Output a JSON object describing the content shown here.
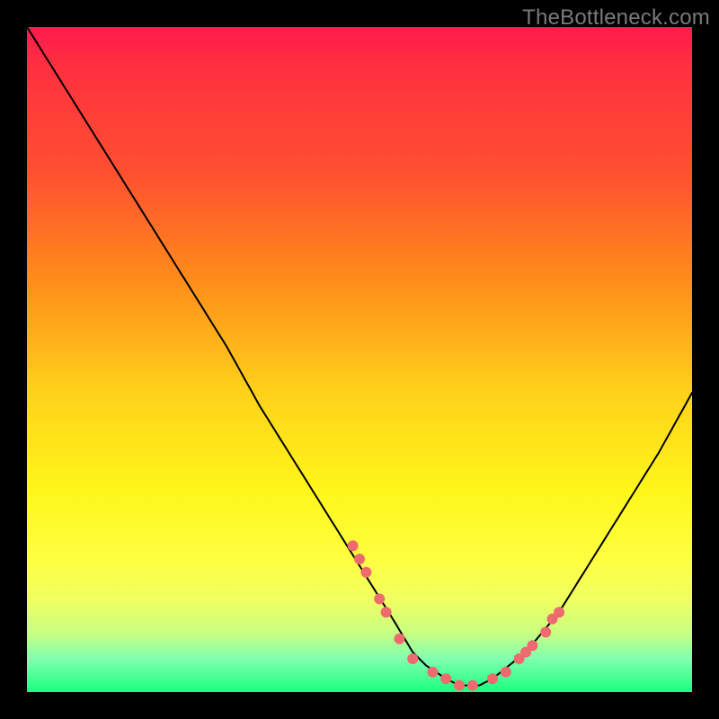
{
  "watermark": "TheBottleneck.com",
  "colors": {
    "background": "#000000",
    "curve_stroke": "#000000",
    "dot_fill": "#ee6a6e",
    "gradient_top": "#ff1a4d",
    "gradient_bottom": "#1aff7d"
  },
  "chart_data": {
    "type": "line",
    "title": "",
    "xlabel": "",
    "ylabel": "",
    "xlim": [
      0,
      100
    ],
    "ylim": [
      0,
      100
    ],
    "grid": false,
    "legend": false,
    "x": [
      0,
      5,
      10,
      15,
      20,
      25,
      30,
      35,
      40,
      45,
      50,
      55,
      58,
      60,
      63,
      65,
      68,
      70,
      75,
      80,
      85,
      90,
      95,
      100
    ],
    "values": [
      100,
      92,
      84,
      76,
      68,
      60,
      52,
      43,
      35,
      27,
      19,
      11,
      6,
      4,
      2,
      1,
      1,
      2,
      6,
      12,
      20,
      28,
      36,
      45
    ],
    "annotations": {
      "comment": "Red dots along the curve near the trough",
      "dots_x": [
        49,
        50,
        51,
        53,
        54,
        56,
        58,
        61,
        63,
        65,
        67,
        70,
        72,
        74,
        75,
        76,
        78,
        79,
        80
      ],
      "dots_y": [
        22,
        20,
        18,
        14,
        12,
        8,
        5,
        3,
        2,
        1,
        1,
        2,
        3,
        5,
        6,
        7,
        9,
        11,
        12
      ]
    }
  }
}
